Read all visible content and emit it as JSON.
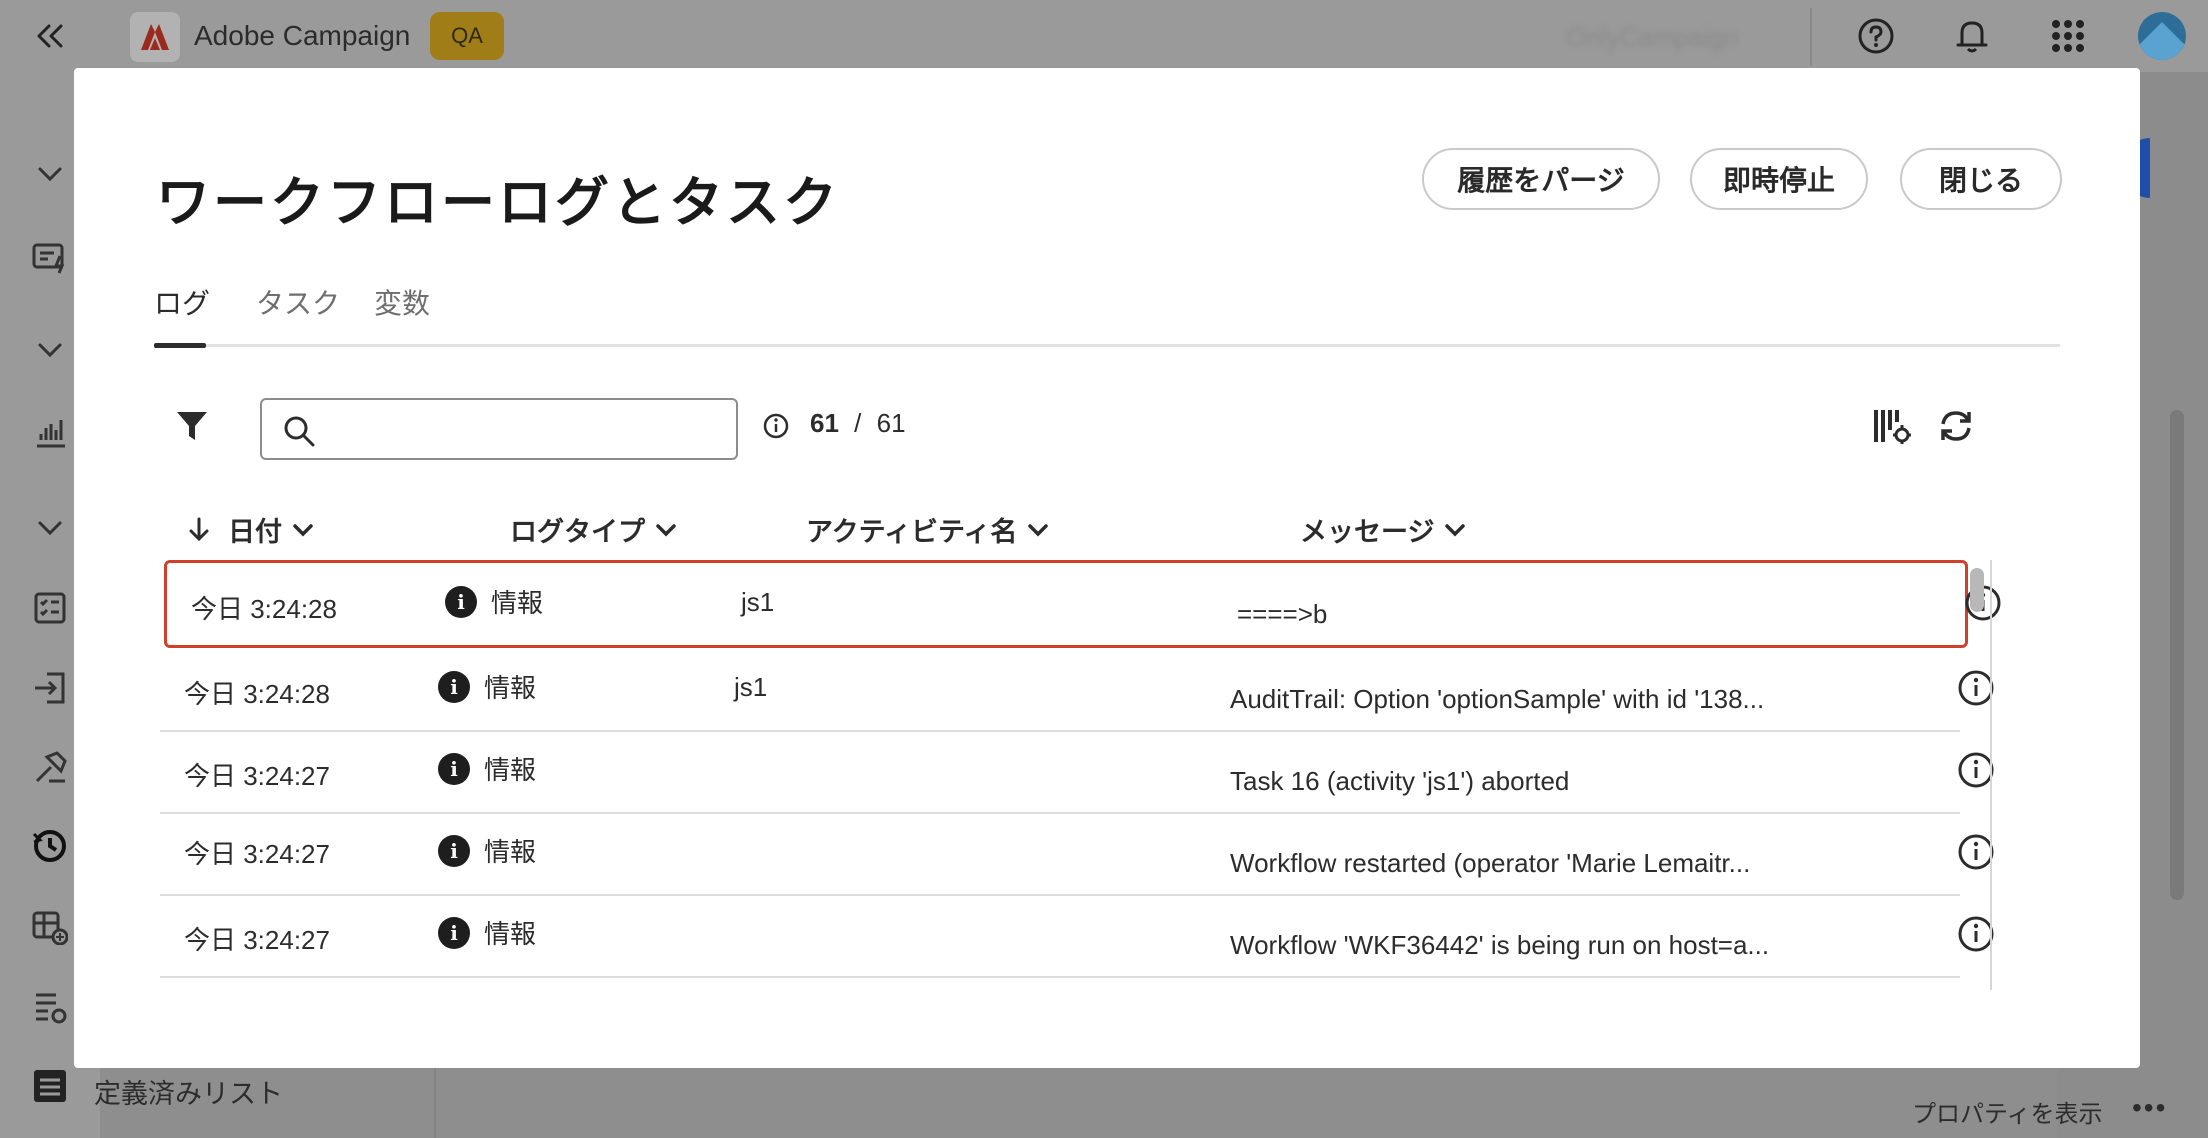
{
  "app": {
    "name": "Adobe Campaign",
    "env_badge": "QA",
    "org": "OnlyCampaign"
  },
  "sidebar": {
    "footer_item": "定義済みリスト"
  },
  "footer": {
    "show_properties": "プロパティを表示",
    "more": "•••"
  },
  "modal": {
    "title": "ワークフローログとタスク",
    "buttons": {
      "purge_history": "履歴をパージ",
      "stop_now": "即時停止",
      "close": "閉じる"
    },
    "tabs": [
      "ログ",
      "タスク",
      "変数"
    ],
    "active_tab": 0,
    "search": {
      "value": "",
      "placeholder": ""
    },
    "count": {
      "shown": "61",
      "separator": "/",
      "total": "61"
    },
    "columns": {
      "date": "日付",
      "log_type": "ログタイプ",
      "activity": "アクティビティ名",
      "message": "メッセージ"
    },
    "rows": [
      {
        "date": "今日 3:24:28",
        "type": "情報",
        "activity": "js1",
        "message": "====>b",
        "selected": true
      },
      {
        "date": "今日 3:24:28",
        "type": "情報",
        "activity": "js1",
        "message": "AuditTrail: Option 'optionSample' with id '138...",
        "selected": false
      },
      {
        "date": "今日 3:24:27",
        "type": "情報",
        "activity": "",
        "message": "Task 16 (activity 'js1') aborted",
        "selected": false
      },
      {
        "date": "今日 3:24:27",
        "type": "情報",
        "activity": "",
        "message": "Workflow restarted (operator 'Marie Lemaitr...",
        "selected": false
      },
      {
        "date": "今日 3:24:27",
        "type": "情報",
        "activity": "",
        "message": "Workflow 'WKF36442' is being run on host=a...",
        "selected": false
      }
    ]
  },
  "colors": {
    "selection_border": "#d0412b",
    "qa_badge": "#a07d17",
    "overlay": "#8f8f8f"
  },
  "icons": {
    "filter": "filter-icon",
    "search": "search-icon",
    "info": "info-icon",
    "column_settings": "column-settings-icon",
    "refresh": "refresh-icon",
    "sort_desc": "arrow-down-icon"
  }
}
